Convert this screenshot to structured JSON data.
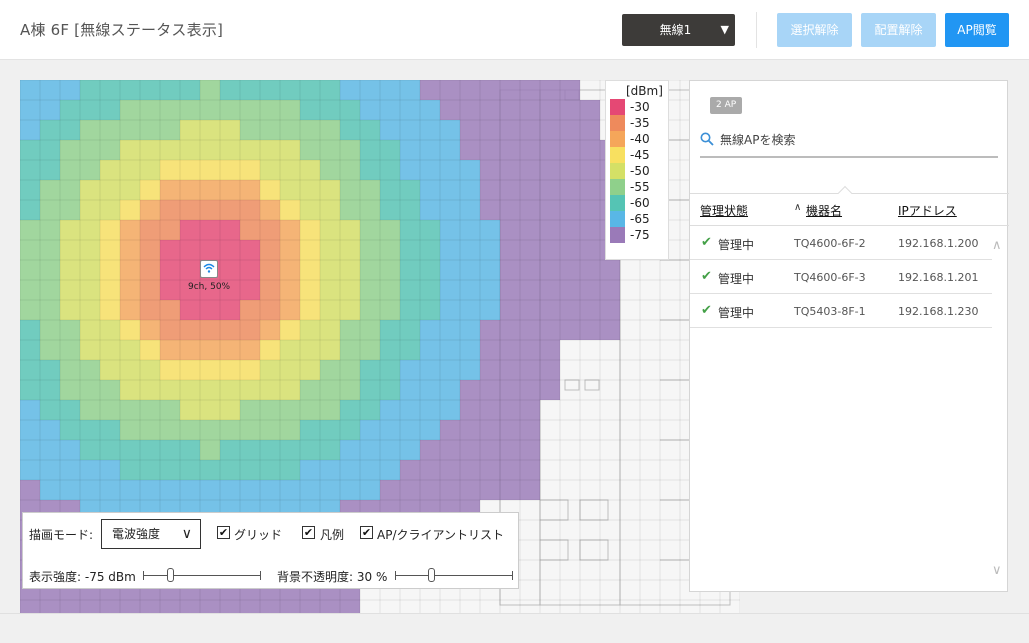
{
  "header": {
    "title": "A棟 6F [無線ステータス表示]",
    "radio_select": "無線1",
    "buttons": {
      "deselect": "選択解除",
      "unplace": "配置解除",
      "ap_view": "AP閲覧"
    }
  },
  "map": {
    "ap_label": "9ch, 50%",
    "heat_colors": {
      "-30": "#e54874",
      "-35": "#ee8a5c",
      "-40": "#f5a65a",
      "-45": "#f8e060",
      "-50": "#d4e066",
      "-55": "#8fd08b",
      "-60": "#55c4b4",
      "-65": "#59b7e6",
      "-75": "#9a7ab8"
    }
  },
  "legend": {
    "title": "[dBm]",
    "items": [
      {
        "label": "-30",
        "color": "#e54874"
      },
      {
        "label": "-35",
        "color": "#ee8a5c"
      },
      {
        "label": "-40",
        "color": "#f5a65a"
      },
      {
        "label": "-45",
        "color": "#f8e060"
      },
      {
        "label": "-50",
        "color": "#d4e066"
      },
      {
        "label": "-55",
        "color": "#8fd08b"
      },
      {
        "label": "-60",
        "color": "#55c4b4"
      },
      {
        "label": "-65",
        "color": "#59b7e6"
      },
      {
        "label": "-75",
        "color": "#9a7ab8"
      }
    ]
  },
  "controls": {
    "mode_label": "描画モード:",
    "mode_value": "電波強度",
    "grid_label": "グリッド",
    "legend_label": "凡例",
    "aplist_label": "AP/クライアントリスト",
    "strength_label": "表示強度: -75 dBm",
    "strength_fraction": 0.22,
    "opacity_label": "背景不透明度: 30 %",
    "opacity_fraction": 0.3
  },
  "panel": {
    "ap_count": "2 AP",
    "search_placeholder": "無線APを検索",
    "columns": {
      "status": "管理状態",
      "name": "機器名",
      "ip": "IPアドレス"
    },
    "rows": [
      {
        "status": "管理中",
        "name": "TQ4600-6F-2",
        "ip": "192.168.1.200"
      },
      {
        "status": "管理中",
        "name": "TQ4600-6F-3",
        "ip": "192.168.1.201"
      },
      {
        "status": "管理中",
        "name": "TQ5403-8F-1",
        "ip": "192.168.1.230"
      }
    ]
  }
}
